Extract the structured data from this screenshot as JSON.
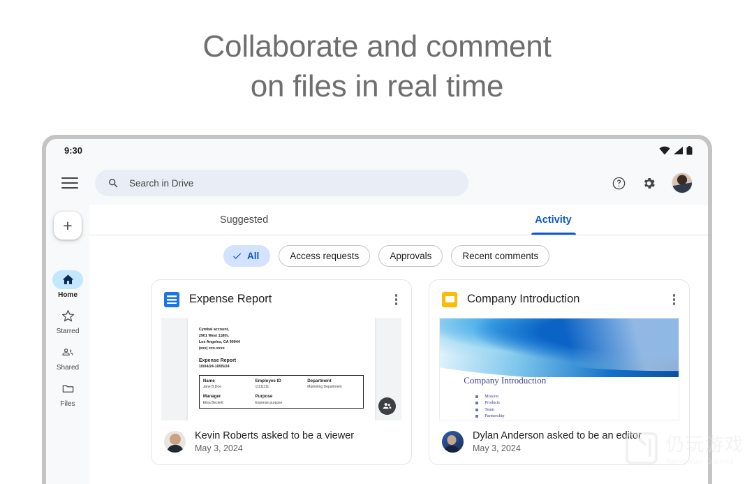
{
  "headline": {
    "line1": "Collaborate and comment",
    "line2": "on files in real time"
  },
  "statusbar": {
    "time": "9:30",
    "icons": [
      "wifi-icon",
      "cellular-signal-icon",
      "battery-icon"
    ]
  },
  "appbar": {
    "menu_icon": "hamburger-menu-icon",
    "search": {
      "icon": "search-icon",
      "placeholder": "Search in Drive",
      "value": ""
    },
    "help_icon": "help-circle-icon",
    "settings_icon": "gear-icon",
    "avatar": "user-avatar"
  },
  "sidebar": {
    "create_label": "+",
    "items": [
      {
        "label": "Home",
        "icon": "home-icon",
        "active": true
      },
      {
        "label": "Starred",
        "icon": "star-icon",
        "active": false
      },
      {
        "label": "Shared",
        "icon": "people-icon",
        "active": false
      },
      {
        "label": "Files",
        "icon": "folder-icon",
        "active": false
      }
    ]
  },
  "tabs": [
    {
      "label": "Suggested",
      "active": false
    },
    {
      "label": "Activity",
      "active": true
    }
  ],
  "chips": [
    {
      "label": "All",
      "selected": true,
      "icon": "check-icon"
    },
    {
      "label": "Access requests",
      "selected": false
    },
    {
      "label": "Approvals",
      "selected": false
    },
    {
      "label": "Recent comments",
      "selected": false
    }
  ],
  "cards": [
    {
      "title": "Expense Report",
      "icon": "google-docs-icon",
      "menu_icon": "kebab-menu-icon",
      "badge_icon": "shared-people-icon",
      "preview": {
        "address": [
          "Cymbal account,",
          "2901 West 118th,",
          "Los Angeles, CA 90044",
          "(xxx) xxx-xxxx"
        ],
        "report_title": "Expense Report",
        "report_date": "10/04/24-10/05/24",
        "table": {
          "headers_row1": [
            "Name",
            "Employee ID",
            "Department"
          ],
          "values_row1": [
            "Jane B.Doe",
            "11111111",
            "Marketing Department"
          ],
          "headers_row2": [
            "Manager",
            "Purpose"
          ],
          "values_row2": [
            "Elisa Beckett",
            "Expense purpose"
          ]
        }
      },
      "activity": {
        "text": "Kevin Roberts asked to be a viewer",
        "date": "May 3, 2024",
        "avatar": "kevin-roberts-avatar"
      }
    },
    {
      "title": "Company Introduction",
      "icon": "google-slides-icon",
      "menu_icon": "kebab-menu-icon",
      "preview": {
        "slide_title": "Company Introduction",
        "bullets": [
          "Mission",
          "Products",
          "Team",
          "Partnership"
        ]
      },
      "activity": {
        "text": "Dylan Anderson asked to be an editor",
        "date": "May 3, 2024",
        "avatar": "dylan-anderson-avatar"
      }
    }
  ],
  "watermark": {
    "cn": "仍玩游戏",
    "en": "Rengwan Games"
  },
  "colors": {
    "accent": "#0b57d0",
    "chip_selected_bg": "#d3e3fd",
    "nav_active_bg": "#c2e7ff",
    "docs_blue": "#1a73e8",
    "slides_yellow": "#fbbc04"
  }
}
